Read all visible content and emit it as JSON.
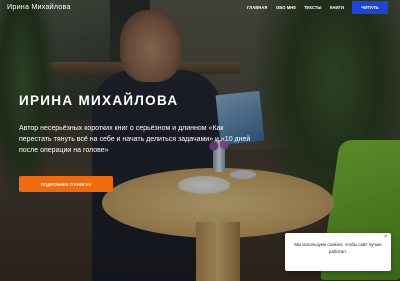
{
  "header": {
    "site_title": "Ирина Михайлова",
    "nav": [
      {
        "label": "ГЛАВНАЯ"
      },
      {
        "label": "ОБО МНЕ"
      },
      {
        "label": "ТЕКСТЫ"
      },
      {
        "label": "КНИГИ"
      }
    ],
    "read_label": "ЧИТАТЬ"
  },
  "hero": {
    "title": "ИРИНА МИХАЙЛОВА",
    "description": "Автор несерьёзных коротких книг о серьёзном и длинном «Как перестать тянуть всё на себе и начать делиться задачами» и «10 дней после операции на голове»",
    "cta_label": "ПОДРОБНЕЕ О КНИГАХ"
  },
  "cookie": {
    "text": "Мы используем cookies, чтобы сайт лучше работал.",
    "close_icon": "close-icon"
  },
  "colors": {
    "accent_blue": "#1e44d8",
    "accent_orange": "#f06a12"
  }
}
